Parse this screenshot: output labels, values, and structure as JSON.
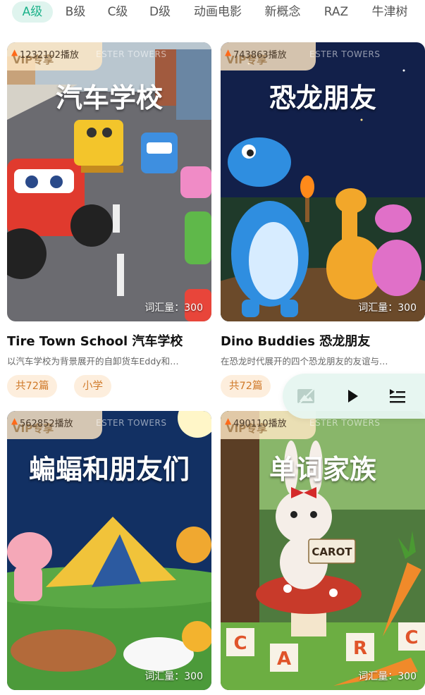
{
  "tabs": [
    "A级",
    "B级",
    "C级",
    "D级",
    "动画电影",
    "新概念",
    "RAZ",
    "牛津树"
  ],
  "active_tab": 0,
  "vip_label": "VIP专享",
  "watermark": "ESTER TOWERS",
  "cards": [
    {
      "plays": "1232102播放",
      "cover_title": "汽车学校",
      "vocab": "词汇量：300",
      "title": "Tire Town School 汽车学校",
      "desc": "以汽车学校为背景展开的自卸货车Eddy和…",
      "tags": [
        "共72篇",
        "小学"
      ]
    },
    {
      "plays": "743863播放",
      "cover_title": "恐龙朋友",
      "vocab": "词汇量：300",
      "title": "Dino Buddies 恐龙朋友",
      "desc": "在恐龙时代展开的四个恐龙朋友的友谊与…",
      "tags": [
        "共72篇"
      ]
    },
    {
      "plays": "562852播放",
      "cover_title": "蝙蝠和朋友们",
      "vocab": "词汇量：300"
    },
    {
      "plays": "490110播放",
      "cover_title": "单词家族",
      "vocab": "词汇量：300",
      "sign_text": "CAROT",
      "blocks": [
        "C",
        "A",
        "R",
        "C"
      ]
    }
  ],
  "player": {
    "icons": [
      "image-placeholder-icon",
      "play-icon",
      "playlist-icon"
    ]
  }
}
